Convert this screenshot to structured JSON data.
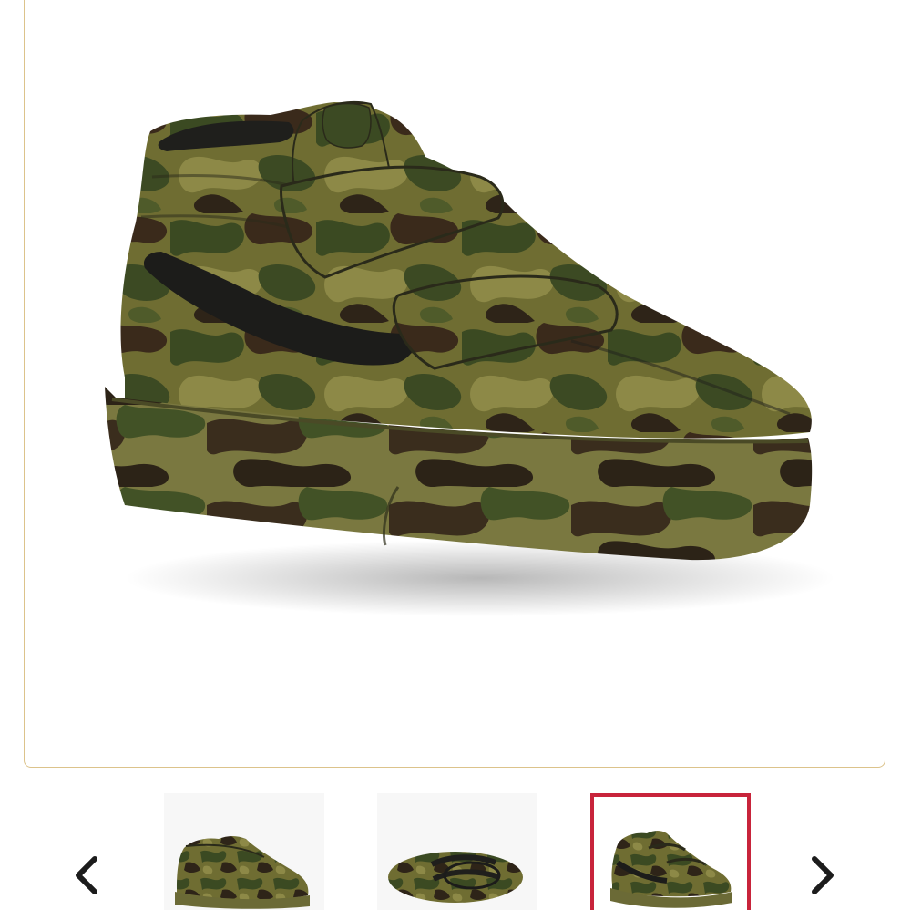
{
  "gallery": {
    "main_image": {
      "icon": "camo-mid-skate-velcro-shoe-image",
      "frame_border_color": "#dcc38b"
    },
    "thumbnails": [
      {
        "icon": "shoe-side-view-thumbnail",
        "selected": false
      },
      {
        "icon": "shoe-top-view-thumbnail",
        "selected": false
      },
      {
        "icon": "shoe-angle-view-thumbnail",
        "selected": true
      }
    ],
    "selected_border_color": "#c8243b",
    "prev_icon": "chevron-left-icon",
    "next_icon": "chevron-right-icon"
  },
  "colors": {
    "camo_olive": "#6b6a2e",
    "camo_dark_green": "#3c4a23",
    "camo_brown": "#3b2a1c",
    "camo_khaki": "#8f8a4a",
    "stripe_black": "#1c1c1a"
  }
}
